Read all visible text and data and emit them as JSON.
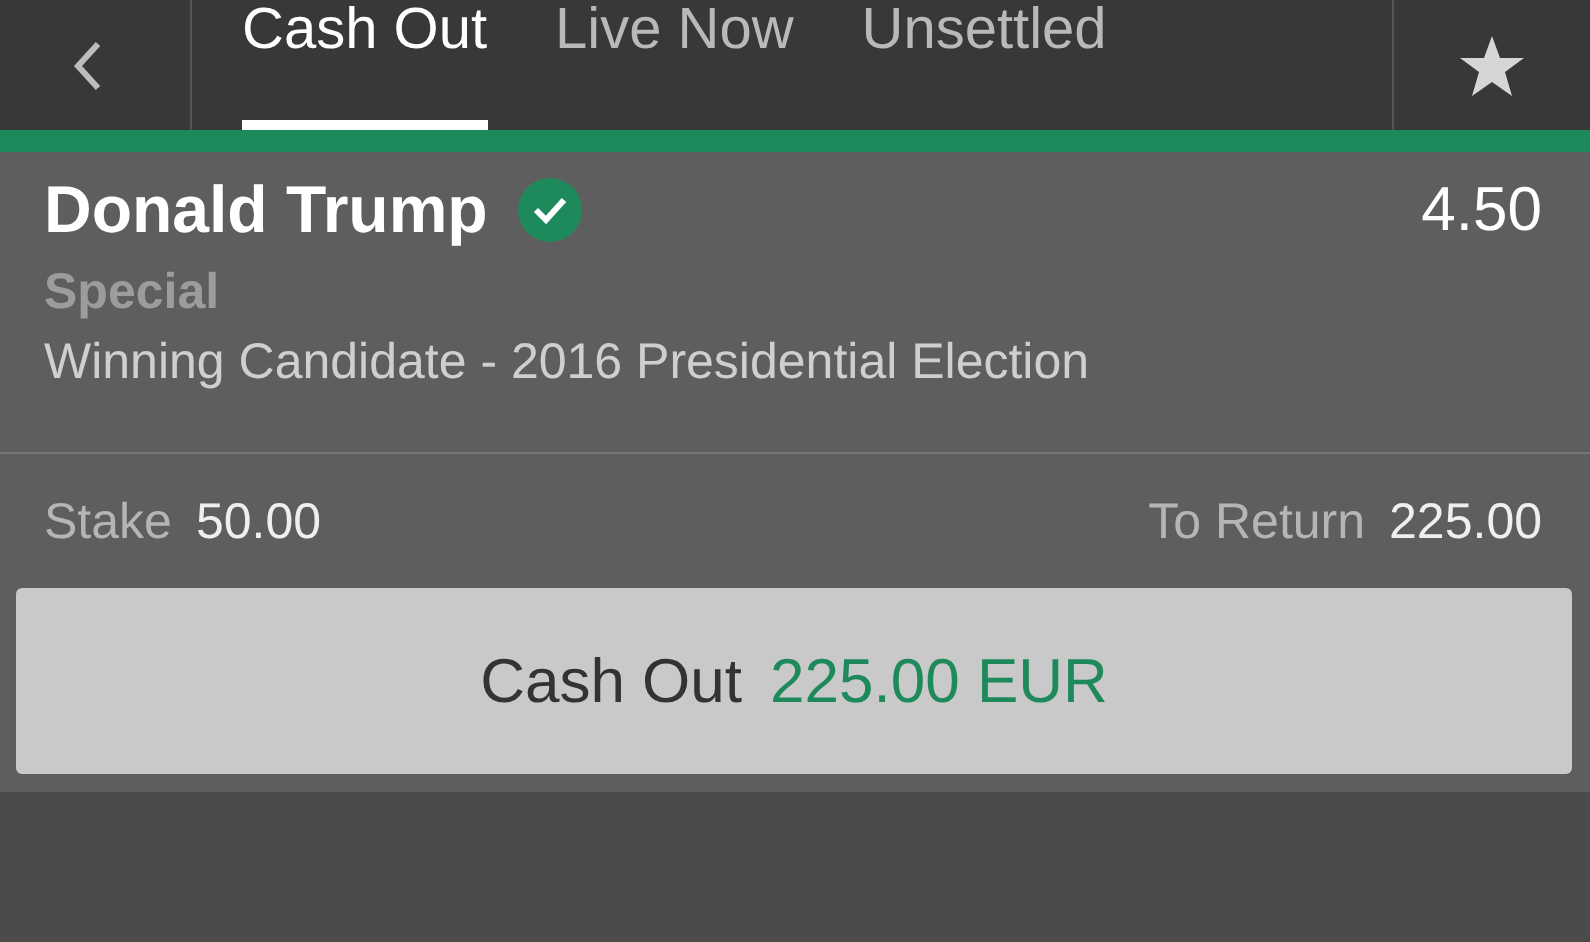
{
  "tabs": [
    {
      "label": "Cash Out",
      "selected": true
    },
    {
      "label": "Live Now",
      "selected": false
    },
    {
      "label": "Unsettled",
      "selected": false
    }
  ],
  "bet": {
    "selection": "Donald Trump",
    "verified": true,
    "odds": "4.50",
    "market_type": "Special",
    "market": "Winning Candidate - 2016 Presidential Election",
    "stake_label": "Stake",
    "stake": "50.00",
    "return_label": "To Return",
    "return": "225.00"
  },
  "cash_out_button": {
    "label": "Cash Out",
    "amount": "225.00 EUR"
  }
}
